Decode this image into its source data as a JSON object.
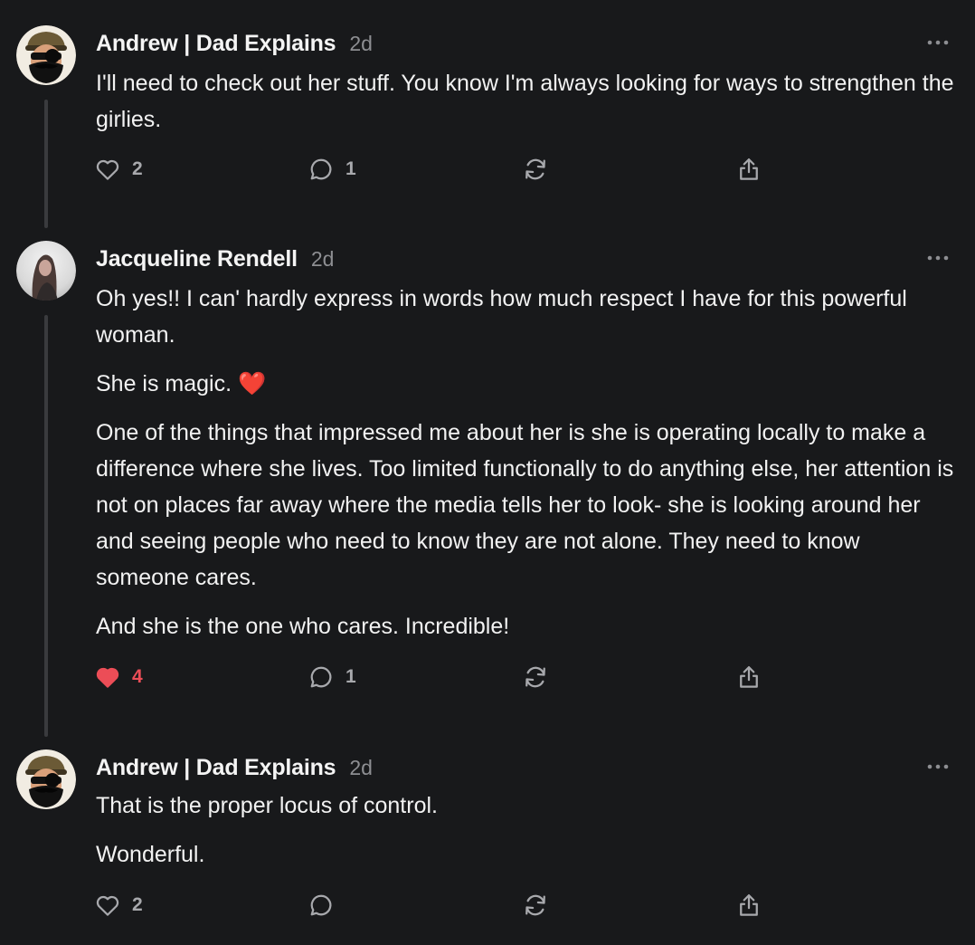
{
  "colors": {
    "background": "#18191b",
    "text": "#f2f2f2",
    "muted": "#8d8e92",
    "like_active": "#ec4d57",
    "thread_line": "#3a3b3e"
  },
  "comments": [
    {
      "author": "Andrew | Dad Explains",
      "time": "2d",
      "avatar_icon": "bearded-sunglasses-avatar-icon",
      "paragraphs": [
        "I'll need to check out her stuff. You know I'm always looking for ways to strengthen the girlies."
      ],
      "likes": "2",
      "liked": false,
      "replies": "1"
    },
    {
      "author": "Jacqueline Rendell",
      "time": "2d",
      "avatar_icon": "photo-avatar-icon",
      "paragraphs": [
        "Oh yes!! I can' hardly express in words how much respect I have for this powerful woman.",
        "She is magic. ❤️",
        "One of the things that impressed me about her is she is operating locally to make a difference where she lives. Too limited functionally to do anything else, her attention is not on places far away where the media tells her to look- she is looking around her and seeing people who need to know they are not alone. They need to know someone cares.",
        "And she is the one who cares. Incredible!"
      ],
      "likes": "4",
      "liked": true,
      "replies": "1"
    },
    {
      "author": "Andrew | Dad Explains",
      "time": "2d",
      "avatar_icon": "bearded-sunglasses-avatar-icon",
      "paragraphs": [
        "That is the proper locus of control.",
        "Wonderful."
      ],
      "likes": "2",
      "liked": false,
      "replies": ""
    }
  ]
}
